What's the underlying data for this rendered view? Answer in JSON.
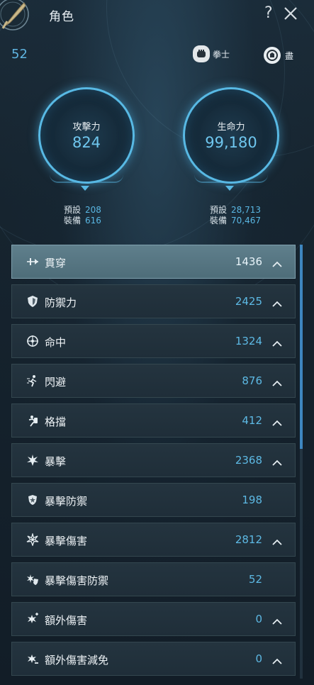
{
  "header": {
    "title": "角色",
    "help_label": "?",
    "close_label": "close"
  },
  "character": {
    "level": "52",
    "class_name": "拳士",
    "realm_name": "盡"
  },
  "attack": {
    "label": "攻擊力",
    "value": "824",
    "base_label": "預設",
    "base_value": "208",
    "equip_label": "裝備",
    "equip_value": "616"
  },
  "health": {
    "label": "生命力",
    "value": "99,180",
    "base_label": "預設",
    "base_value": "28,713",
    "equip_label": "裝備",
    "equip_value": "70,467"
  },
  "stats": [
    {
      "name": "貫穿",
      "value": "1436",
      "icon": "pierce-icon",
      "expandable": true,
      "active": true
    },
    {
      "name": "防禦力",
      "value": "2425",
      "icon": "shield-icon",
      "expandable": true
    },
    {
      "name": "命中",
      "value": "1324",
      "icon": "crosshair-icon",
      "expandable": true
    },
    {
      "name": "閃避",
      "value": "876",
      "icon": "dodge-icon",
      "expandable": true
    },
    {
      "name": "格擋",
      "value": "412",
      "icon": "block-icon",
      "expandable": true
    },
    {
      "name": "暴擊",
      "value": "2368",
      "icon": "critical-icon",
      "expandable": true
    },
    {
      "name": "暴擊防禦",
      "value": "198",
      "icon": "critical-defense-icon",
      "expandable": false
    },
    {
      "name": "暴擊傷害",
      "value": "2812",
      "icon": "critical-damage-icon",
      "expandable": true
    },
    {
      "name": "暴擊傷害防禦",
      "value": "52",
      "icon": "critical-damage-defense-icon",
      "expandable": false
    },
    {
      "name": "額外傷害",
      "value": "0",
      "icon": "extra-damage-icon",
      "expandable": true
    },
    {
      "name": "額外傷害減免",
      "value": "0",
      "icon": "extra-damage-reduction-icon",
      "expandable": true
    }
  ],
  "scroll": {
    "position": 0.0,
    "visible_fraction": 0.47
  },
  "colors": {
    "accent": "#58b9e4",
    "value_blue": "#5db9e4",
    "active_row": "#5f7f8c",
    "row_bg": "#24343f"
  }
}
